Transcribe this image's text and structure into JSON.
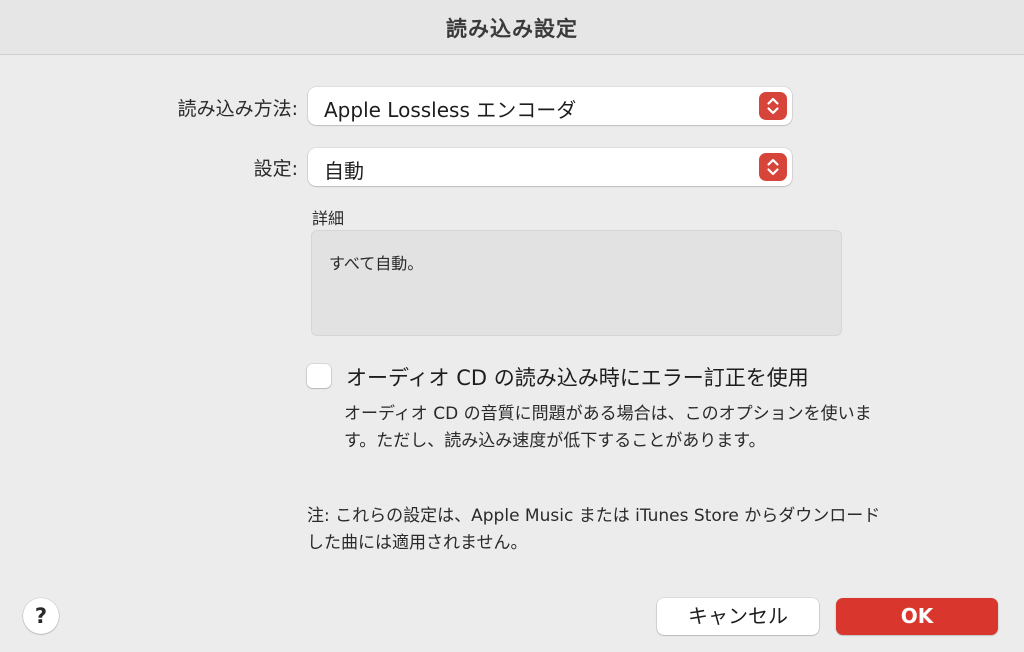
{
  "window": {
    "title": "読み込み設定"
  },
  "import_method": {
    "label": "読み込み方法:",
    "value": "Apple Lossless エンコーダ",
    "stepper_icon": "chevron-up-down-icon"
  },
  "setting": {
    "label": "設定:",
    "value": "自動",
    "stepper_icon": "chevron-up-down-icon"
  },
  "details": {
    "label": "詳細",
    "text": "すべて自動。"
  },
  "error_correction": {
    "checked": false,
    "label": "オーディオ CD の読み込み時にエラー訂正を使用",
    "help": "オーディオ CD の音質に問題がある場合は、このオプションを使います。ただし、読み込み速度が低下することがあります。"
  },
  "note": "注: これらの設定は、Apple Music または iTunes Store からダウンロードした曲には適用されません。",
  "buttons": {
    "help": "?",
    "cancel": "キャンセル",
    "ok": "OK"
  },
  "colors": {
    "accent": "#d9362d",
    "window_bg": "#ececec"
  }
}
